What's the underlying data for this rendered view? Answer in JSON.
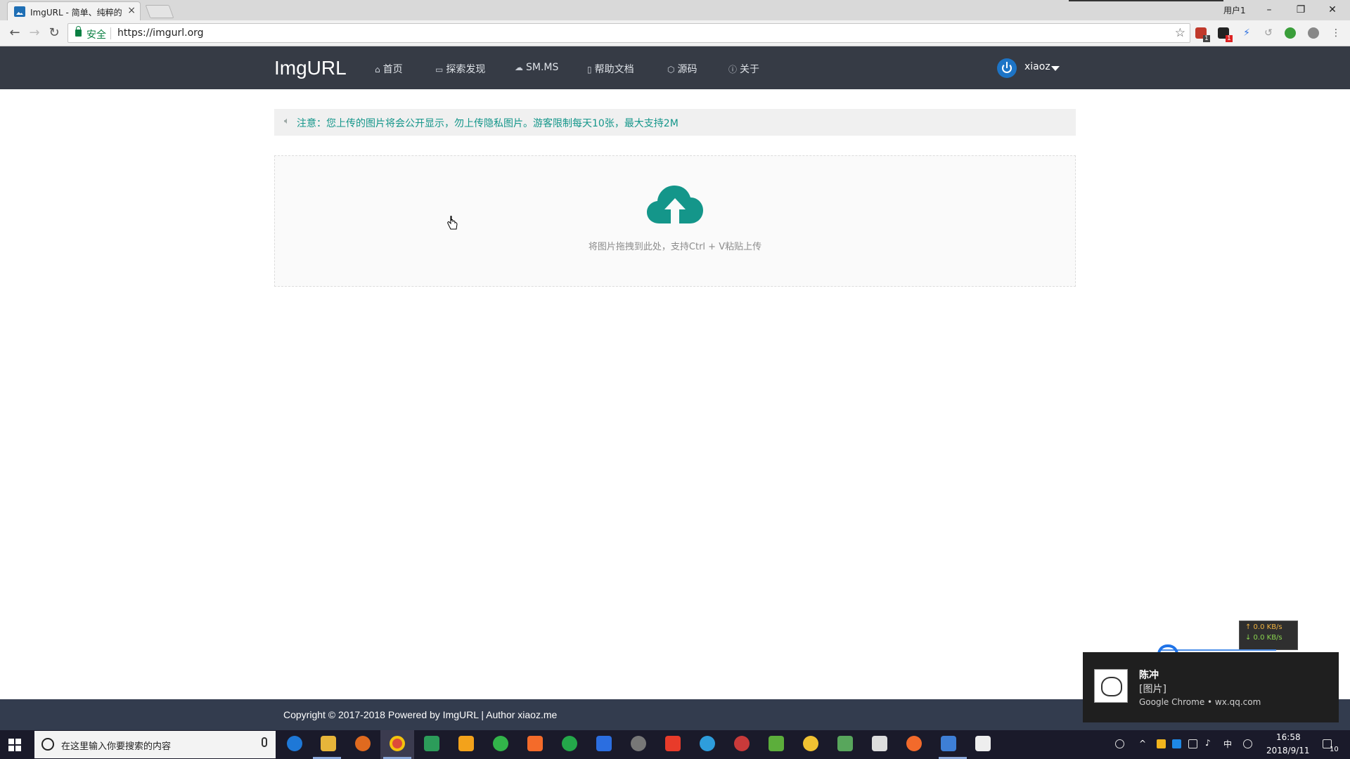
{
  "browser": {
    "tab_title": "ImgURL - 简单、纯粹的",
    "tab_close": "×",
    "window_user": "用户1",
    "secure_label": "安全",
    "url": "https://imgurl.org",
    "badge_counts": [
      "1",
      "1"
    ]
  },
  "site": {
    "brand": "ImgURL",
    "nav": [
      {
        "label": "首页",
        "icon": "home-icon",
        "glyph": "⌂"
      },
      {
        "label": "探索发现",
        "icon": "image-icon",
        "glyph": "▭"
      },
      {
        "label": "SM.MS",
        "icon": "cloud-icon",
        "glyph": "☁"
      },
      {
        "label": "帮助文档",
        "icon": "book-icon",
        "glyph": "▯"
      },
      {
        "label": "源码",
        "icon": "cube-icon",
        "glyph": "⬡"
      },
      {
        "label": "关于",
        "icon": "info-icon",
        "glyph": "ⓘ"
      }
    ],
    "user": "xiaoz",
    "notice": "注意：您上传的图片将会公开显示，勿上传隐私图片。游客限制每天10张，最大支持2M",
    "drop_text": "将图片拖拽到此处，支持Ctrl + V粘贴上传",
    "footer": "Copyright © 2017-2018 Powered by ImgURL | Author xiaoz.me",
    "accent_color": "#14968a",
    "navbar_color": "#363b45"
  },
  "netmeter": {
    "up": "↑ 0.0 KB/s",
    "down": "↓ 0.0 KB/s"
  },
  "notification": {
    "sender": "陈冲",
    "message": "[图片]",
    "source": "Google Chrome • wx.qq.com"
  },
  "taskbar": {
    "search_placeholder": "在这里输入你要搜索的内容",
    "ime": "中",
    "time": "16:58",
    "date": "2018/9/11",
    "notification_count": "10"
  }
}
